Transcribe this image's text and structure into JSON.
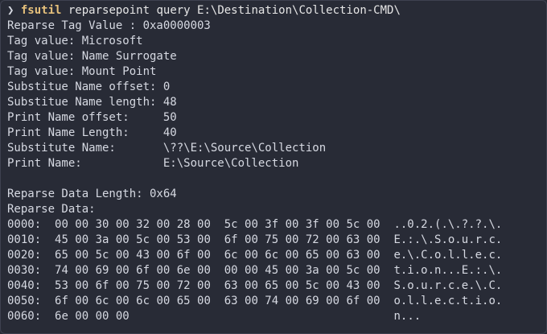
{
  "terminal": {
    "prompt_symbol": "❯",
    "command": "fsutil",
    "command_args": " reparsepoint query E:\\Destination\\Collection-CMD\\",
    "output_lines": [
      "Reparse Tag Value : 0xa0000003",
      "Tag value: Microsoft",
      "Tag value: Name Surrogate",
      "Tag value: Mount Point",
      "Substitue Name offset: 0",
      "Substitue Name length: 48",
      "Print Name offset:     50",
      "Print Name Length:     40",
      "Substitute Name:       \\??\\E:\\Source\\Collection",
      "Print Name:            E:\\Source\\Collection",
      "",
      "Reparse Data Length: 0x64",
      "Reparse Data:"
    ],
    "hex_dump": [
      {
        "offset": "0000:",
        "bytes": "00 00 30 00 32 00 28 00  5c 00 3f 00 3f 00 5c 00",
        "ascii": "..0.2.(.\\.?.?.\\."
      },
      {
        "offset": "0010:",
        "bytes": "45 00 3a 00 5c 00 53 00  6f 00 75 00 72 00 63 00",
        "ascii": "E.:.\\.S.o.u.r.c."
      },
      {
        "offset": "0020:",
        "bytes": "65 00 5c 00 43 00 6f 00  6c 00 6c 00 65 00 63 00",
        "ascii": "e.\\.C.o.l.l.e.c."
      },
      {
        "offset": "0030:",
        "bytes": "74 00 69 00 6f 00 6e 00  00 00 45 00 3a 00 5c 00",
        "ascii": "t.i.o.n...E.:.\\."
      },
      {
        "offset": "0040:",
        "bytes": "53 00 6f 00 75 00 72 00  63 00 65 00 5c 00 43 00",
        "ascii": "S.o.u.r.c.e.\\.C."
      },
      {
        "offset": "0050:",
        "bytes": "6f 00 6c 00 6c 00 65 00  63 00 74 00 69 00 6f 00",
        "ascii": "o.l.l.e.c.t.i.o."
      },
      {
        "offset": "0060:",
        "bytes": "6e 00 00 00",
        "ascii": "n..."
      }
    ]
  }
}
